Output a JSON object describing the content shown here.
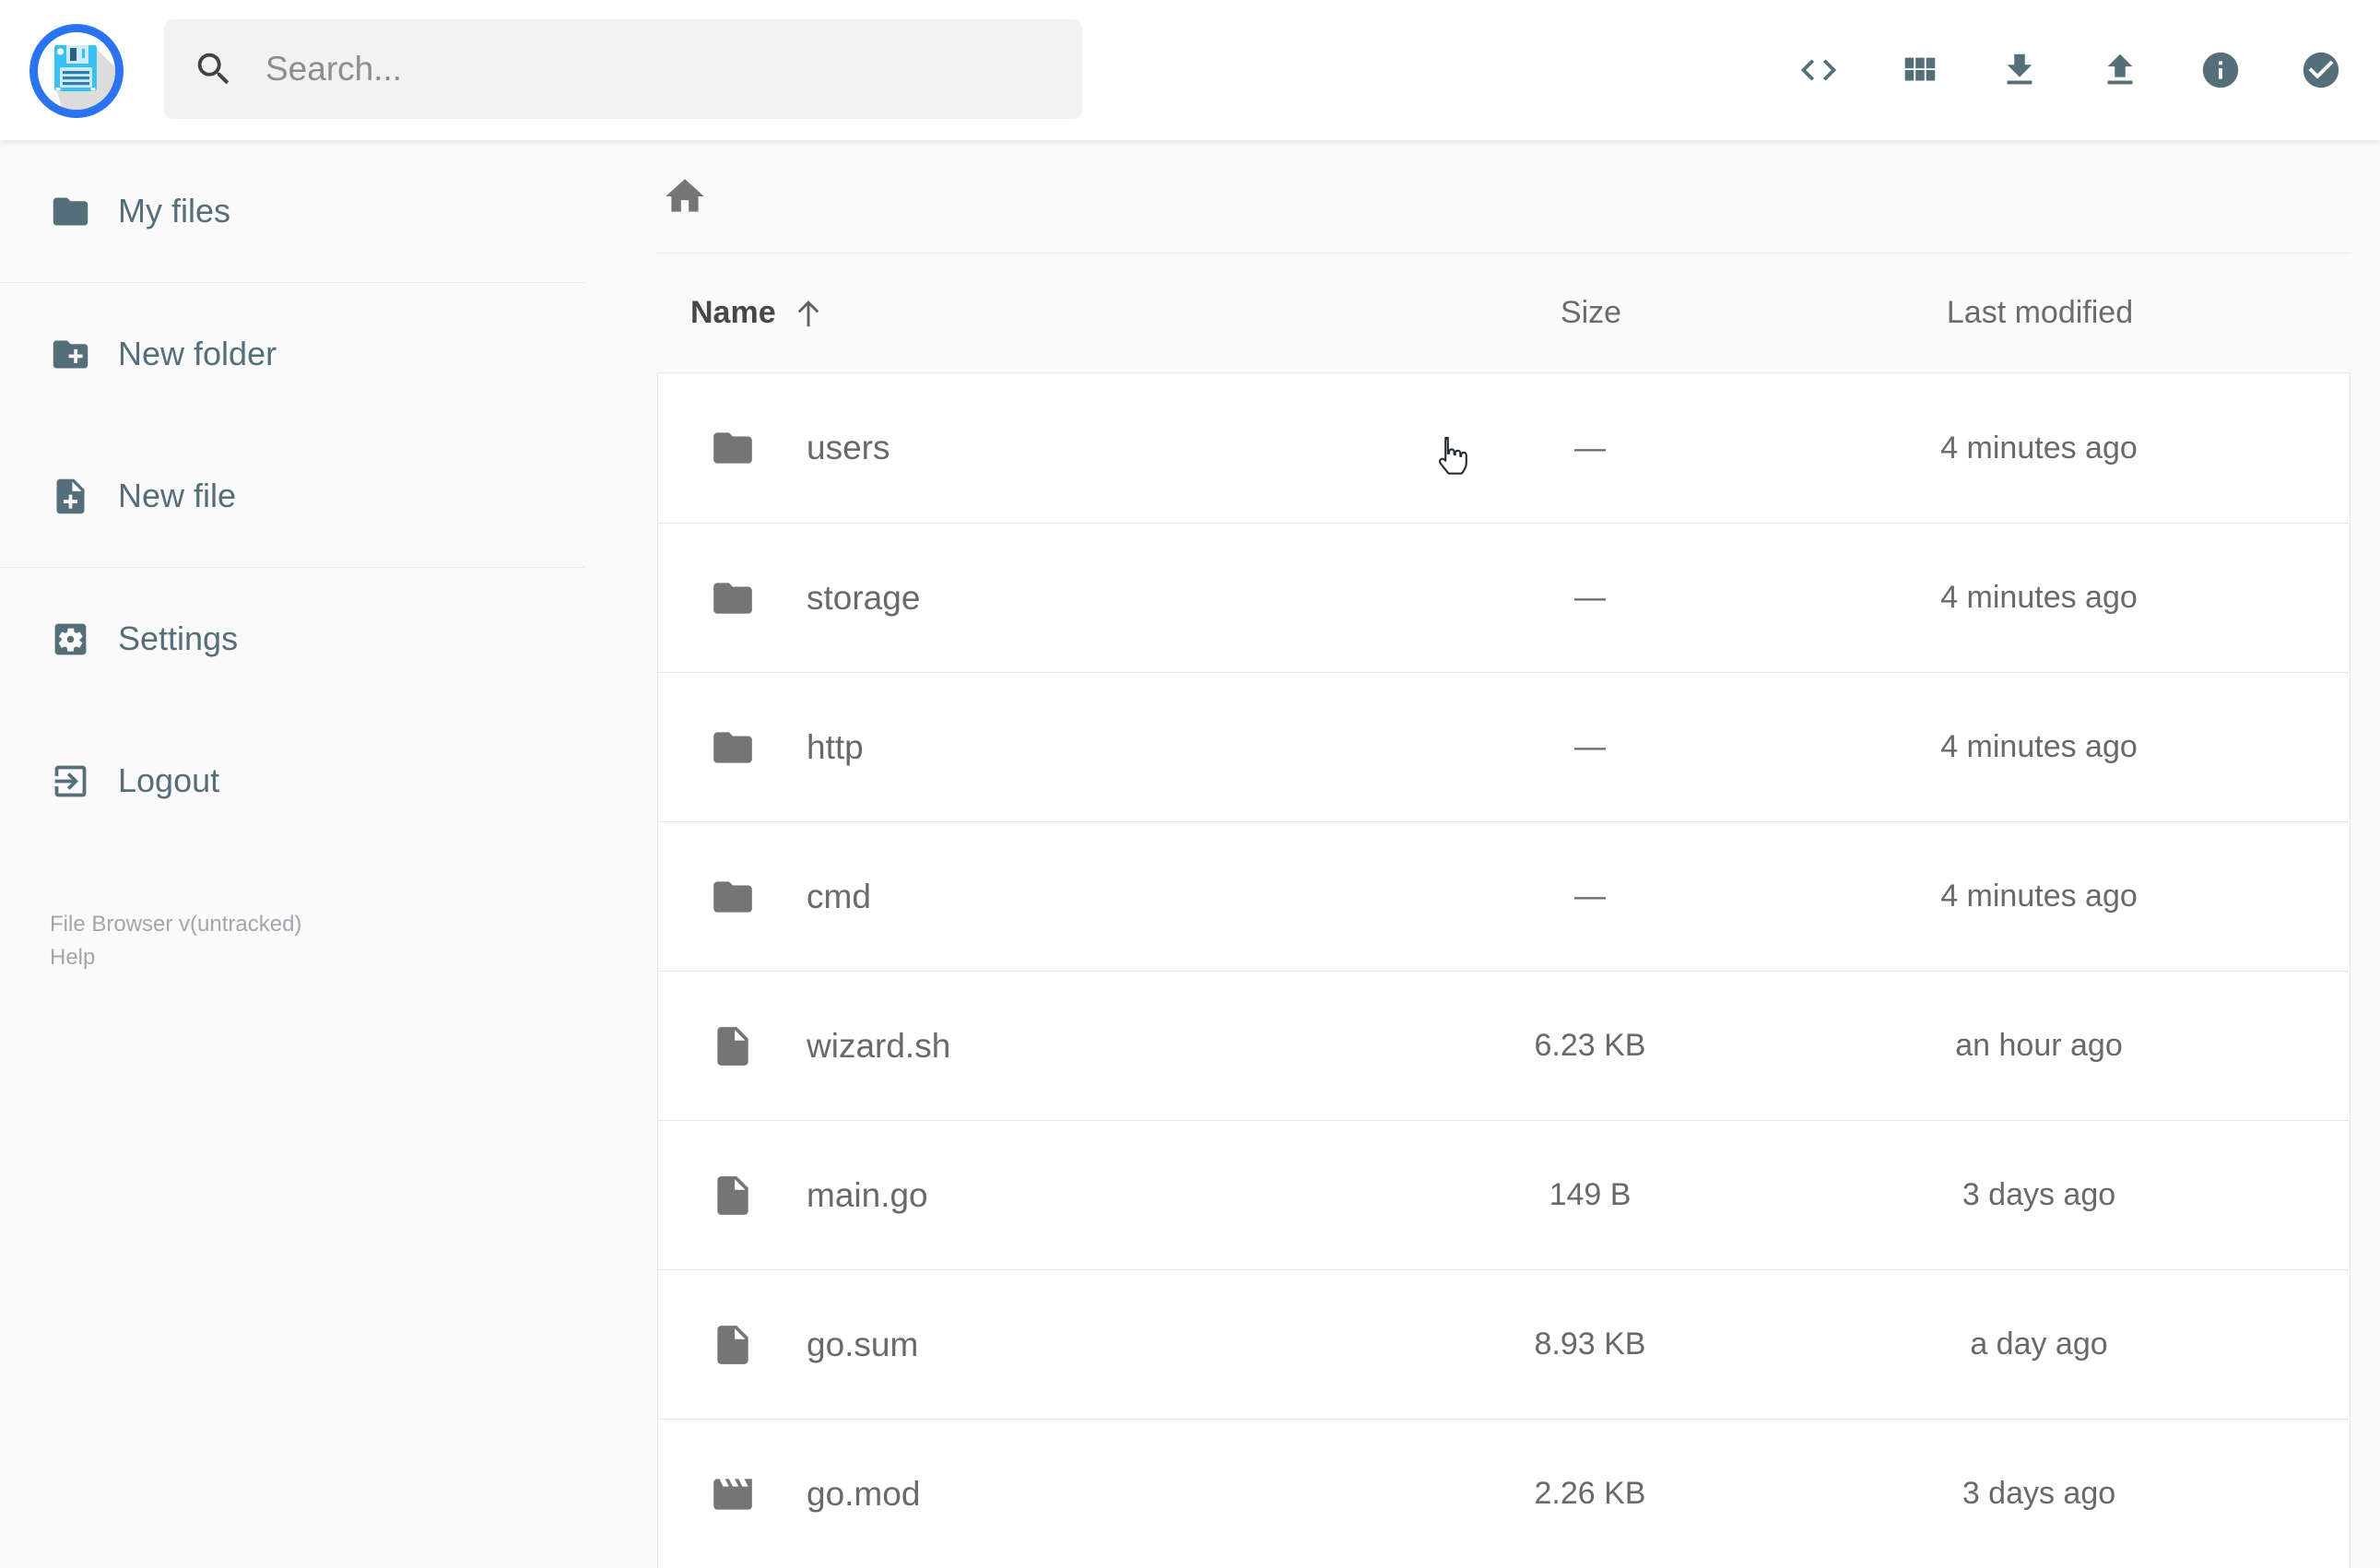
{
  "header": {
    "search": {
      "placeholder": "Search..."
    },
    "actions": [
      {
        "label": "Open shell",
        "icon": "code-icon"
      },
      {
        "label": "Switch view",
        "icon": "grid-view-icon"
      },
      {
        "label": "Download",
        "icon": "download-icon"
      },
      {
        "label": "Upload",
        "icon": "upload-icon"
      },
      {
        "label": "Info",
        "icon": "info-icon"
      },
      {
        "label": "Select multiple",
        "icon": "check-circle-icon"
      }
    ]
  },
  "sidebar": {
    "items": [
      {
        "label": "My files",
        "icon": "folder-icon"
      },
      {
        "label": "New folder",
        "icon": "folder-plus-icon"
      },
      {
        "label": "New file",
        "icon": "file-plus-icon"
      },
      {
        "label": "Settings",
        "icon": "gear-icon"
      },
      {
        "label": "Logout",
        "icon": "logout-icon"
      }
    ],
    "footer": {
      "version": "File Browser v(untracked)",
      "help": "Help"
    }
  },
  "breadcrumb": {
    "home_icon": "home-icon"
  },
  "listing": {
    "columns": {
      "name": "Name",
      "size": "Size",
      "modified": "Last modified"
    },
    "sort": {
      "column": "name",
      "direction": "ascending",
      "icon": "arrow-up-icon"
    },
    "rows": [
      {
        "name": "users",
        "type": "folder",
        "size": "—",
        "modified": "4 minutes ago"
      },
      {
        "name": "storage",
        "type": "folder",
        "size": "—",
        "modified": "4 minutes ago"
      },
      {
        "name": "http",
        "type": "folder",
        "size": "—",
        "modified": "4 minutes ago"
      },
      {
        "name": "cmd",
        "type": "folder",
        "size": "—",
        "modified": "4 minutes ago"
      },
      {
        "name": "wizard.sh",
        "type": "file",
        "size": "6.23 KB",
        "modified": "an hour ago"
      },
      {
        "name": "main.go",
        "type": "file",
        "size": "149 B",
        "modified": "3 days ago"
      },
      {
        "name": "go.sum",
        "type": "file",
        "size": "8.93 KB",
        "modified": "a day ago"
      },
      {
        "name": "go.mod",
        "type": "movie",
        "size": "2.26 KB",
        "modified": "3 days ago"
      }
    ]
  },
  "colors": {
    "accent_blue": "#2b74f1",
    "logo_cyan": "#38c5f4",
    "slate_icon": "#546e7a",
    "row_icon_gray": "#757575",
    "text_gray": "#696969",
    "page_bg": "#fafafa",
    "header_bg": "#ffffff",
    "search_bg": "#f2f2f2",
    "divider": "#e7e7e7"
  }
}
